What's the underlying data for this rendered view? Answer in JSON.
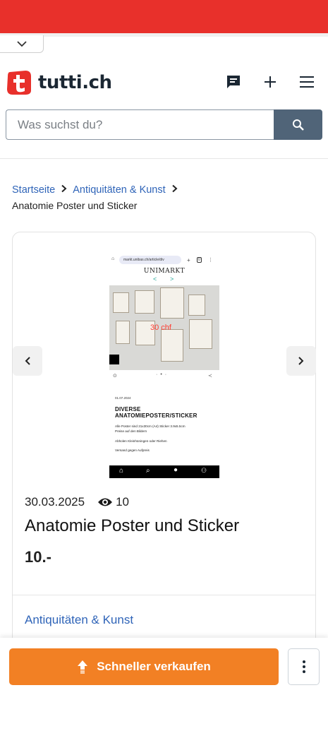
{
  "app": {
    "brand": "tutti.ch",
    "accent": "#e8302b",
    "link_color": "#2f64b8",
    "cta_color": "#f28024"
  },
  "search": {
    "placeholder": "Was suchst du?",
    "icon": "search-icon"
  },
  "header": {
    "icons": [
      "chat-icon",
      "plus-icon",
      "menu-icon"
    ]
  },
  "breadcrumb": {
    "items": [
      "Startseite",
      "Antiquitäten & Kunst"
    ],
    "current": "Anatomie Poster und Sticker"
  },
  "listing": {
    "date": "30.03.2025",
    "views": "10",
    "title": "Anatomie Poster und Sticker",
    "price": "10.-",
    "category": "Antiquitäten & Kunst",
    "image": {
      "url_text": "markt.unibas.ch/article/div",
      "brand": "UNIMARKT",
      "price_overlay": "30 chf",
      "date": "01.07.2024",
      "title": "DIVERSE ANATOMIEPOSTER/STICKER",
      "line1": "Alle Poster sind 21x30cm (A4) Sticker 3.9x5.5cm",
      "line2": "Preise auf den Bildern",
      "line3": "Abholen Kleinhüningen oder Riehen",
      "line4": "Versand gegen Aufpreis"
    }
  },
  "actions": {
    "sell_label": "Schneller verkaufen"
  }
}
